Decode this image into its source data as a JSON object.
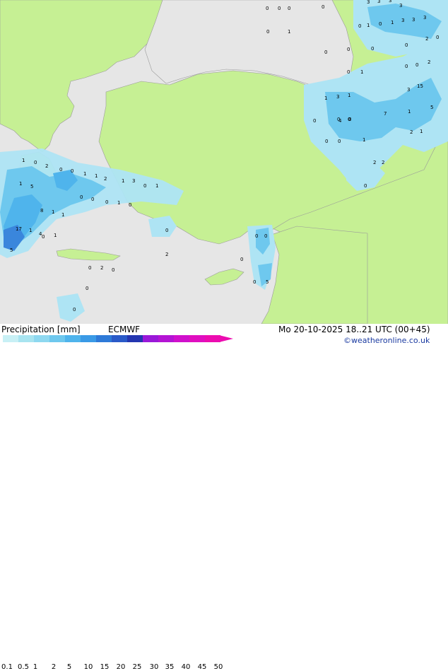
{
  "title": "Precipitation [mm]",
  "model": "ECMWF",
  "valid_time": "Mo 20-10-2025 18..21 UTC (00+45)",
  "credit": "©weatheronline.co.uk",
  "scale": {
    "ticks": [
      "0.1",
      "0.5",
      "1",
      "2",
      "5",
      "10",
      "15",
      "20",
      "25",
      "30",
      "35",
      "40",
      "45",
      "50"
    ],
    "colors": [
      "#c8f0f5",
      "#a8e4f0",
      "#8ed8f0",
      "#6ec8ee",
      "#4fb4ec",
      "#3a9ae6",
      "#2e7ad8",
      "#2a5ac8",
      "#2436b0",
      "#9a18d8",
      "#b414d4",
      "#d010cc",
      "#e00ec0",
      "#ec0cb0"
    ]
  },
  "colors": {
    "land": "#c6f094",
    "sea_dry": "#e8e8e8",
    "rain_light": "#aee4f4",
    "rain_moderate": "#6ec8ee",
    "rain_heavy": "#3a86dc"
  },
  "map_values": [
    "0",
    "0",
    "0",
    "0",
    "3",
    "3",
    "3",
    "3",
    "0",
    "1",
    "0",
    "1",
    "3",
    "3",
    "3",
    "0",
    "1",
    "0",
    "0",
    "0",
    "2",
    "0",
    "0",
    "0",
    "0",
    "0",
    "1",
    "2",
    "15",
    "3",
    "7",
    "1",
    "5",
    "1",
    "3",
    "1",
    "1",
    "2",
    "0",
    "0",
    "4",
    "0",
    "0",
    "0",
    "0",
    "2",
    "0",
    "2",
    "1",
    "3",
    "1",
    "0",
    "1",
    "2",
    "1",
    "1",
    "0",
    "0",
    "2",
    "0",
    "1",
    "1",
    "5",
    "8",
    "1",
    "4",
    "17",
    "5",
    "1",
    "0",
    "1",
    "1",
    "0",
    "0",
    "0",
    "1",
    "0",
    "0",
    "0",
    "0",
    "2",
    "0",
    "0",
    "5",
    "0",
    "2",
    "0",
    "0",
    "0"
  ]
}
